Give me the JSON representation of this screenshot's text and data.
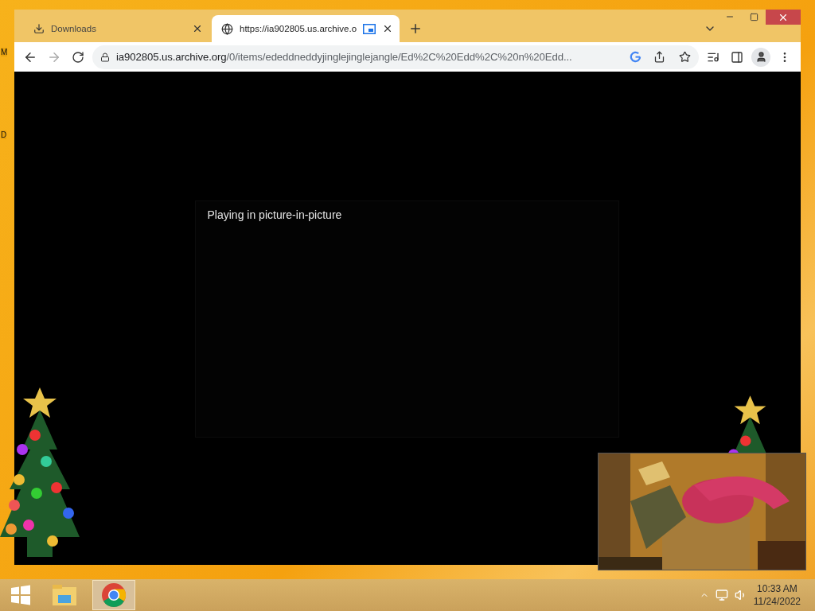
{
  "desktop_labels": [
    "M",
    "D"
  ],
  "browser": {
    "tabs": [
      {
        "kind": "downloads",
        "title": "Downloads",
        "selected": false,
        "pip": false
      },
      {
        "kind": "web",
        "title": "https://ia902805.us.archive.o",
        "selected": true,
        "pip": true
      }
    ],
    "address_host": "ia902805.us.archive.org",
    "address_path": "/0/items/ededdneddyjinglejinglejangle/Ed%2C%20Edd%2C%20n%20Edd...",
    "message": "Playing in picture-in-picture"
  },
  "taskbar": {
    "apps": [
      {
        "kind": "explorer",
        "selected": false
      },
      {
        "kind": "chrome",
        "selected": true
      }
    ],
    "time": "10:33 AM",
    "date": "11/24/2022"
  }
}
